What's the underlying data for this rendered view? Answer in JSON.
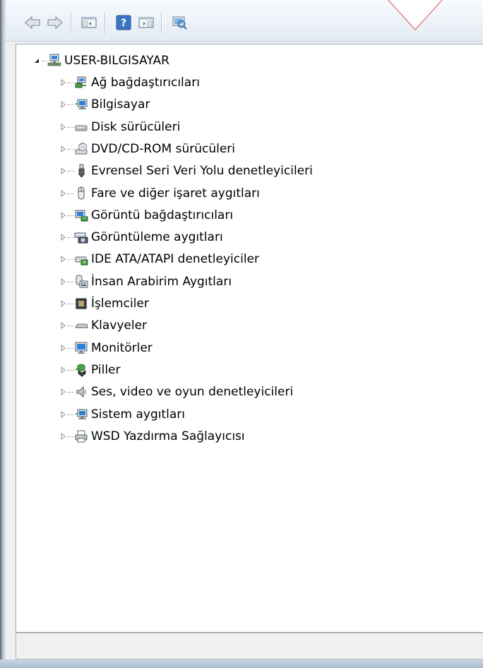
{
  "root": {
    "label": "USER-BILGISAYAR",
    "icon": "computer-network-icon",
    "expanded": true
  },
  "categories": [
    {
      "label": "Ağ bağdaştırıcıları",
      "icon": "network-adapter-icon"
    },
    {
      "label": "Bilgisayar",
      "icon": "computer-icon"
    },
    {
      "label": "Disk sürücüleri",
      "icon": "disk-drive-icon"
    },
    {
      "label": "DVD/CD-ROM sürücüleri",
      "icon": "dvd-drive-icon"
    },
    {
      "label": "Evrensel Seri Veri Yolu denetleyicileri",
      "icon": "usb-icon"
    },
    {
      "label": "Fare ve diğer işaret aygıtları",
      "icon": "mouse-icon"
    },
    {
      "label": "Görüntü bağdaştırıcıları",
      "icon": "display-adapter-icon"
    },
    {
      "label": "Görüntüleme aygıtları",
      "icon": "imaging-device-icon"
    },
    {
      "label": "IDE ATA/ATAPI denetleyiciler",
      "icon": "ide-controller-icon"
    },
    {
      "label": "İnsan Arabirim Aygıtları",
      "icon": "hid-icon"
    },
    {
      "label": "İşlemciler",
      "icon": "processor-icon"
    },
    {
      "label": "Klavyeler",
      "icon": "keyboard-icon"
    },
    {
      "label": "Monitörler",
      "icon": "monitor-icon"
    },
    {
      "label": "Piller",
      "icon": "battery-icon"
    },
    {
      "label": "Ses, video ve oyun denetleyicileri",
      "icon": "speaker-icon"
    },
    {
      "label": "Sistem aygıtları",
      "icon": "system-devices-icon"
    },
    {
      "label": "WSD Yazdırma Sağlayıcısı",
      "icon": "printer-icon"
    }
  ],
  "toolbar": {
    "back": "back-arrow-icon",
    "forward": "forward-arrow-icon",
    "show_hide_console_tree": "console-tree-icon",
    "help": "help-icon",
    "show_hide_action_pane": "action-pane-icon",
    "scan_hardware": "scan-hardware-icon"
  },
  "status_bar": {
    "text": ""
  }
}
